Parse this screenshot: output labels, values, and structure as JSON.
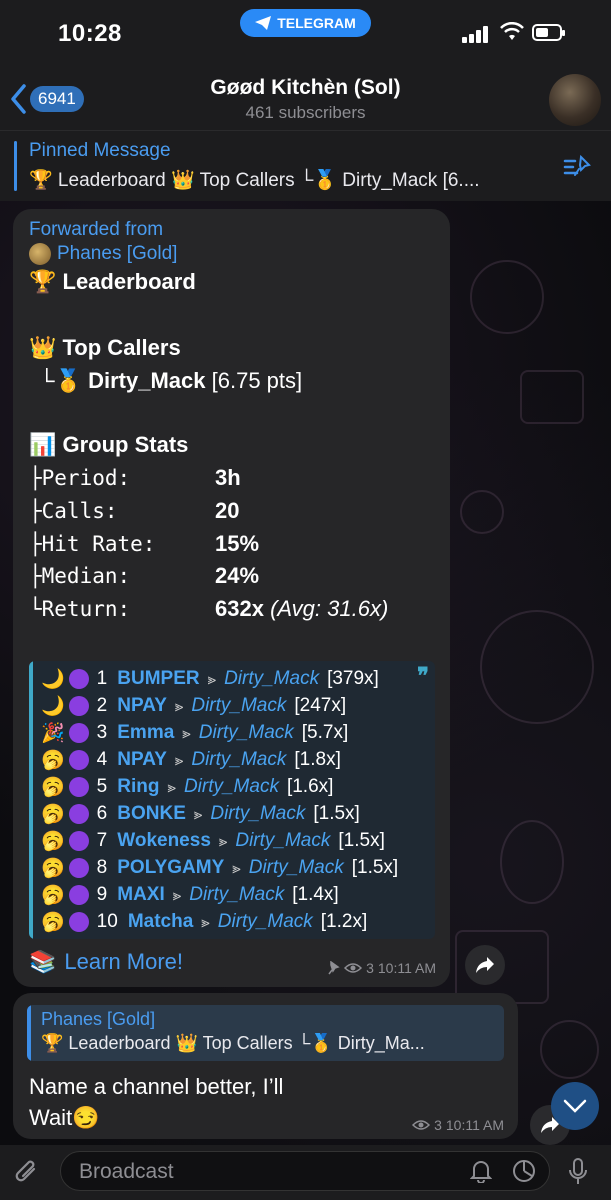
{
  "status_bar": {
    "time": "10:28",
    "banner": "TELEGRAM"
  },
  "header": {
    "back_count": "6941",
    "title": "Gøød Kitchèn (Sol)",
    "subtitle": "461 subscribers"
  },
  "pinned": {
    "label": "Pinned Message",
    "text": "🏆 Leaderboard 👑 Top Callers └🥇 Dirty_Mack [6...."
  },
  "message1": {
    "forwarded_label": "Forwarded from",
    "forwarded_name": "Phanes [Gold]",
    "leaderboard": "🏆 Leaderboard",
    "top_callers": "👑 Top Callers",
    "top_caller_prefix": "└🥇",
    "top_caller_name": "Dirty_Mack",
    "top_caller_pts": "[6.75 pts]",
    "group_stats": "📊 Group Stats",
    "stats": [
      {
        "key": "├Period:",
        "value": "3h",
        "extra": ""
      },
      {
        "key": "├Calls:",
        "value": "20",
        "extra": ""
      },
      {
        "key": "├Hit Rate:",
        "value": "15%",
        "extra": ""
      },
      {
        "key": "├Median:",
        "value": "24%",
        "extra": ""
      },
      {
        "key": "└Return:",
        "value": "632x",
        "extra": "(Avg: 31.6x)"
      }
    ],
    "leaders": [
      {
        "icon": "🌙",
        "rank": "1",
        "token": "BUMPER",
        "user": "Dirty_Mack",
        "mult": "[379x]"
      },
      {
        "icon": "🌙",
        "rank": "2",
        "token": "NPAY",
        "user": "Dirty_Mack",
        "mult": "[247x]"
      },
      {
        "icon": "🎉",
        "rank": "3",
        "token": "Emma",
        "user": "Dirty_Mack",
        "mult": "[5.7x]"
      },
      {
        "icon": "🥱",
        "rank": "4",
        "token": "NPAY",
        "user": "Dirty_Mack",
        "mult": "[1.8x]"
      },
      {
        "icon": "🥱",
        "rank": "5",
        "token": "Ring",
        "user": "Dirty_Mack",
        "mult": "[1.6x]"
      },
      {
        "icon": "🥱",
        "rank": "6",
        "token": "BONKE",
        "user": "Dirty_Mack",
        "mult": "[1.5x]"
      },
      {
        "icon": "🥱",
        "rank": "7",
        "token": "Wokeness",
        "user": "Dirty_Mack",
        "mult": "[1.5x]"
      },
      {
        "icon": "🥱",
        "rank": "8",
        "token": "POLYGAMY",
        "user": "Dirty_Mack",
        "mult": "[1.5x]"
      },
      {
        "icon": "🥱",
        "rank": "9",
        "token": "MAXI",
        "user": "Dirty_Mack",
        "mult": "[1.4x]"
      },
      {
        "icon": "🥱",
        "rank": "10",
        "token": "Matcha",
        "user": "Dirty_Mack",
        "mult": "[1.2x]"
      }
    ],
    "separator": "⪢",
    "learn_more": "Learn More!",
    "views": "3",
    "time": "10:11 AM"
  },
  "message2": {
    "reply_name": "Phanes [Gold]",
    "reply_text": "🏆 Leaderboard 👑 Top Callers └🥇 Dirty_Ma...",
    "text_line1": "Name a channel better, I’ll",
    "text_line2": "Wait😏",
    "views": "3",
    "time": "10:11 AM"
  },
  "composer": {
    "placeholder": "Broadcast"
  },
  "colors": {
    "accent": "#4a9cf0",
    "bubble": "#262628",
    "quote_bar": "#3fa9c9",
    "dot": "#8a3ee0"
  }
}
